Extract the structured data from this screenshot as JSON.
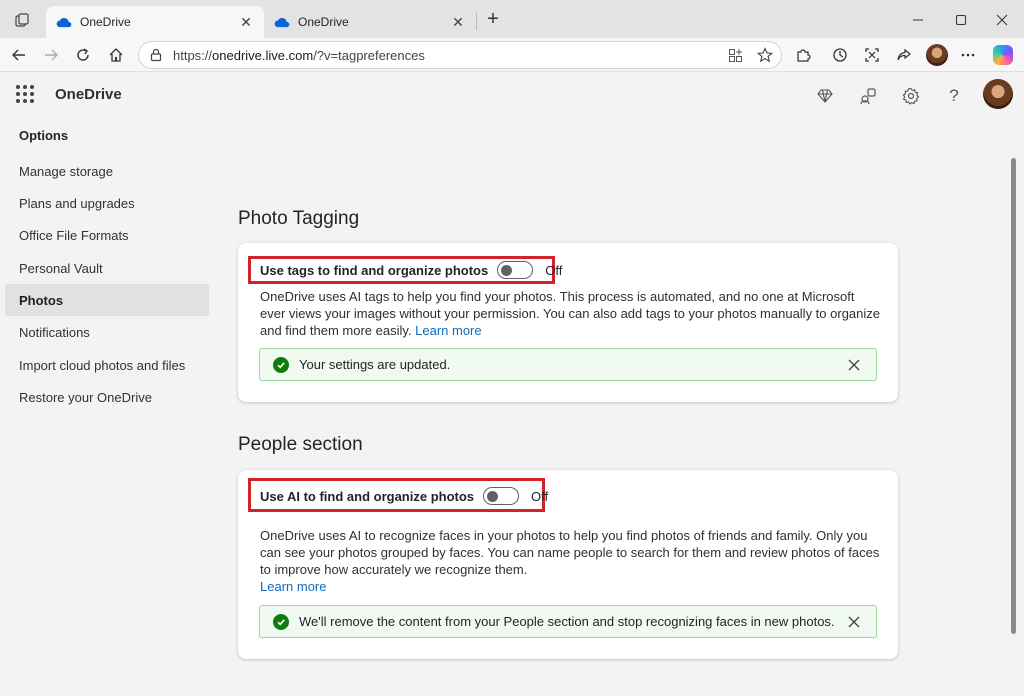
{
  "browser": {
    "tabs": [
      {
        "title": "OneDrive",
        "active": true
      },
      {
        "title": "OneDrive",
        "active": false
      }
    ],
    "url_prefix": "https://",
    "url_host": "onedrive.live.com",
    "url_path": "/?v=tagpreferences"
  },
  "app": {
    "name": "OneDrive"
  },
  "sidebar": {
    "heading": "Options",
    "items": [
      {
        "label": "Manage storage"
      },
      {
        "label": "Plans and upgrades"
      },
      {
        "label": "Office File Formats"
      },
      {
        "label": "Personal Vault"
      },
      {
        "label": "Photos"
      },
      {
        "label": "Notifications"
      },
      {
        "label": "Import cloud photos and files"
      },
      {
        "label": "Restore your OneDrive"
      }
    ]
  },
  "photo_tagging": {
    "title": "Photo Tagging",
    "toggle_label": "Use tags to find and organize photos",
    "toggle_state": "Off",
    "description": "OneDrive uses AI tags to help you find your photos. This process is automated, and no one at Microsoft ever views your images without your permission. You can also add tags to your photos manually to organize and find them more easily.",
    "learn_more": "Learn more",
    "banner": "Your settings are updated."
  },
  "people": {
    "title": "People section",
    "toggle_label": "Use AI to find and organize photos",
    "toggle_state": "Off",
    "description": "OneDrive uses AI to recognize faces in your photos to help you find photos of friends and family. Only you can see your photos grouped by faces. You can name people to search for them and review photos of faces to improve how accurately we recognize them.",
    "learn_more": "Learn more",
    "banner": "We'll remove the content from your People section and stop recognizing faces in new photos."
  },
  "colors": {
    "highlight": "#d2232a",
    "link": "#0f6cbd",
    "success": "#107c10"
  }
}
